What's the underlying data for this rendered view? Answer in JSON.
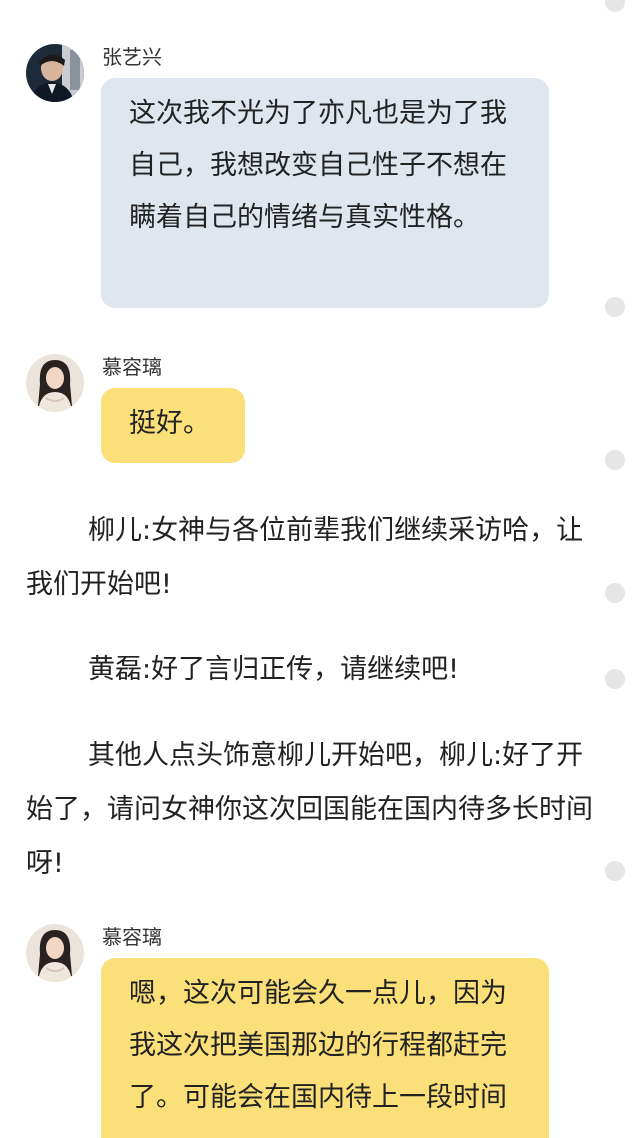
{
  "messages": [
    {
      "name": "张艺兴",
      "text": "这次我不光为了亦凡也是为了我自己，我想改变自己性子不想在瞒着自己的情绪与真实性格。"
    },
    {
      "name": "慕容璃",
      "text": "挺好。"
    },
    {
      "name": "慕容璃",
      "text": "嗯，这次可能会久一点儿，因为我这次把美国那边的行程都赶完了。可能会在国内待上一段时间"
    }
  ],
  "narration": [
    "柳儿:女神与各位前辈我们继续采访哈，让我们开始吧!",
    "黄磊:好了言归正传，请继续吧!",
    "其他人点头饰意柳儿开始吧，柳儿:好了开始了，请问女神你这次回国能在国内待多长时间呀!"
  ],
  "avatars": {
    "zhang": "male-portrait-avatar",
    "murong": "female-portrait-avatar"
  },
  "colors": {
    "bubble_gray": "#dfe6ee",
    "bubble_yellow": "#fbe07a",
    "background": "#ffffff",
    "side_dot": "#e6e6e6"
  }
}
